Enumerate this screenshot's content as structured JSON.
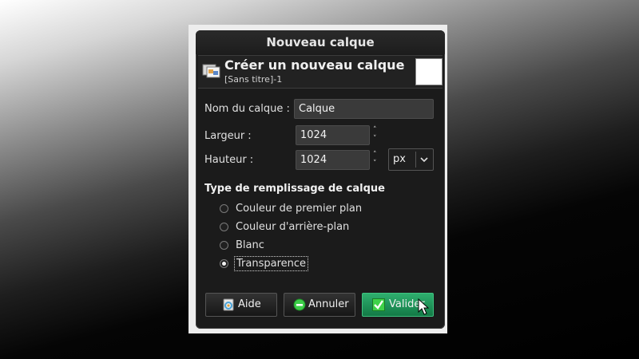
{
  "dialog": {
    "title": "Nouveau calque",
    "header_title": "Créer un nouveau calque",
    "header_subtitle": "[Sans titre]-1"
  },
  "form": {
    "name_label": "Nom du calque :",
    "name_value": "Calque",
    "width_label": "Largeur :",
    "width_value": "1024",
    "height_label": "Hauteur :",
    "height_value": "1024",
    "unit_value": "px"
  },
  "fill": {
    "section_title": "Type de remplissage de calque",
    "options": [
      {
        "label": "Couleur de premier plan",
        "selected": false
      },
      {
        "label": "Couleur d'arrière-plan",
        "selected": false
      },
      {
        "label": "Blanc",
        "selected": false
      },
      {
        "label": "Transparence",
        "selected": true
      }
    ]
  },
  "buttons": {
    "help_label": "Aide",
    "cancel_label": "Annuler",
    "ok_label": "Valider"
  },
  "colors": {
    "dialog_bg": "#1b1b1b",
    "ok_button": "#1f9459",
    "cancel_icon": "#3ccd48",
    "check_icon": "#3fd24a"
  },
  "icons": {
    "header": "new-layer-icon",
    "help": "help-icon",
    "cancel": "cancel-icon",
    "ok": "check-icon",
    "unit_dropdown": "chevron-down-icon"
  }
}
